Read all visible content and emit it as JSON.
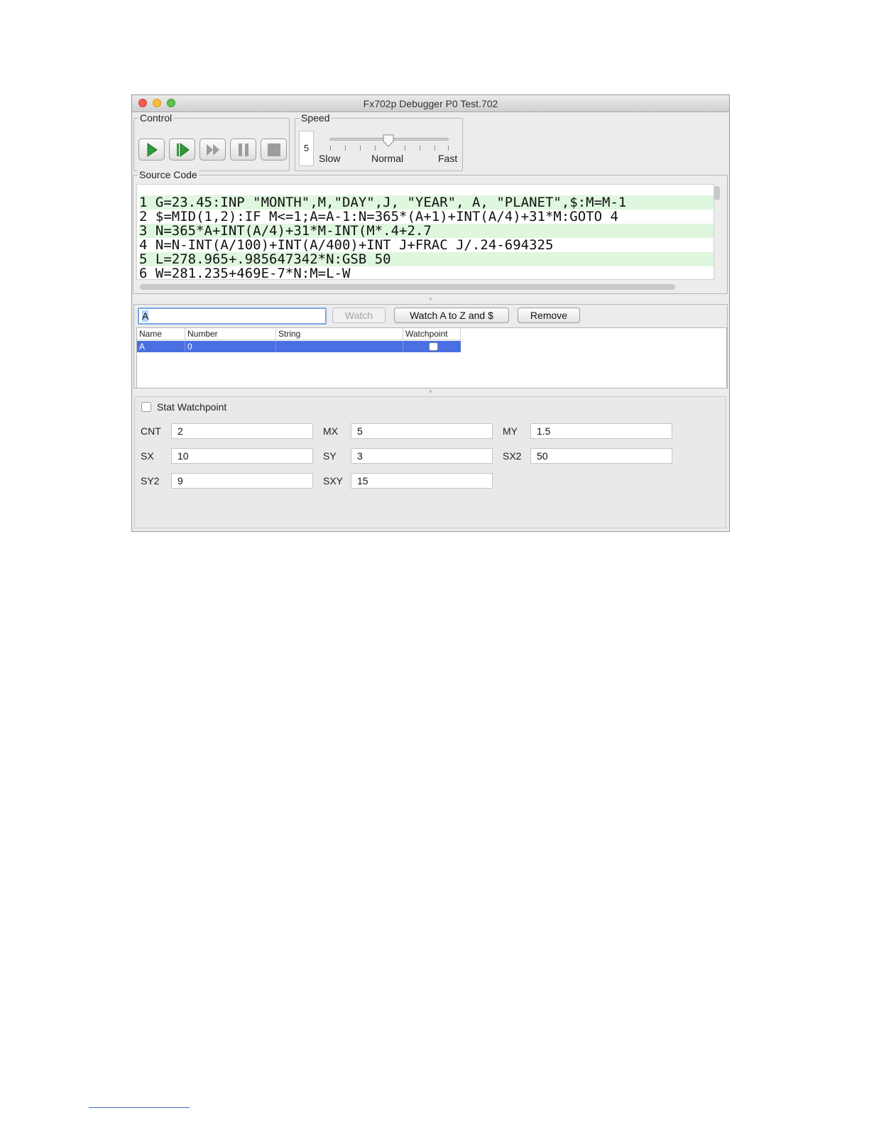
{
  "window": {
    "title": "Fx702p Debugger P0 Test.702"
  },
  "control": {
    "label": "Control",
    "buttons": [
      "run-icon",
      "step-icon",
      "fast-forward-icon",
      "pause-icon",
      "stop-icon"
    ]
  },
  "speed": {
    "label": "Speed",
    "value": "5",
    "slow_label": "Slow",
    "normal_label": "Normal",
    "fast_label": "Fast",
    "level": 0.5
  },
  "source": {
    "label": "Source Code",
    "lines": [
      "1 G=23.45:INP \"MONTH\",M,\"DAY\",J, \"YEAR\", A, \"PLANET\",$:M=M-1",
      "2 $=MID(1,2):IF M<=1;A=A-1:N=365*(A+1)+INT(A/4)+31*M:GOTO 4",
      "3 N=365*A+INT(A/4)+31*M-INT(M*.4+2.7",
      "4 N=N-INT(A/100)+INT(A/400)+INT J+FRAC J/.24-694325",
      "5 L=278.965+.985647342*N:GSB 50",
      "6 W=281.235+469E-7*N:M=L-W"
    ]
  },
  "watch": {
    "input_value": "A",
    "watch_button": "Watch",
    "watch_all_button": "Watch A to Z and $",
    "remove_button": "Remove",
    "columns": [
      "Name",
      "Number",
      "String",
      "Watchpoint"
    ],
    "rows": [
      {
        "name": "A",
        "number": "0",
        "string": "",
        "watchpoint": false
      }
    ]
  },
  "stats": {
    "watchpoint_label": "Stat Watchpoint",
    "cnt_label": "CNT",
    "cnt": "2",
    "mx_label": "MX",
    "mx": "5",
    "my_label": "MY",
    "my": "1.5",
    "sx_label": "SX",
    "sx": "10",
    "sy_label": "SY",
    "sy": "3",
    "sx2_label": "SX2",
    "sx2": "50",
    "sy2_label": "SY2",
    "sy2": "9",
    "sxy_label": "SXY",
    "sxy": "15"
  },
  "colors": {
    "selection": "#4a6fe3",
    "highlight_line": "#dff6df",
    "focus_ring": "#7ba7e1"
  }
}
